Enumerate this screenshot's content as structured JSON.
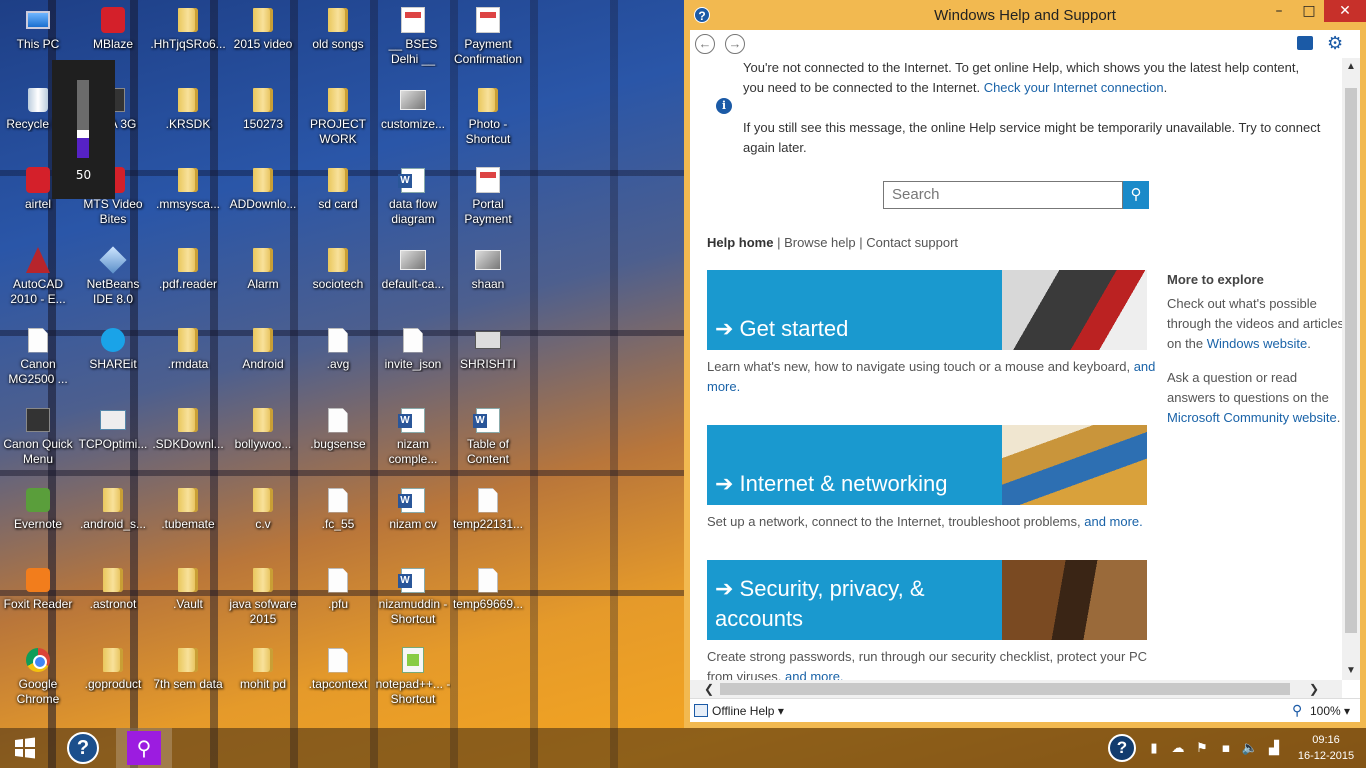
{
  "desktop": {
    "icons": [
      {
        "label": "This PC",
        "glyph": "g-pc",
        "icon": "this-pc-icon"
      },
      {
        "label": "MBlaze",
        "glyph": "g-red",
        "icon": "mblaze-icon"
      },
      {
        "label": ".HhTjqSRo6...",
        "glyph": "g-folder",
        "icon": "folder-icon"
      },
      {
        "label": "2015 video",
        "glyph": "g-folder",
        "icon": "folder-icon"
      },
      {
        "label": "old songs",
        "glyph": "g-folder",
        "icon": "folder-icon"
      },
      {
        "label": "__ BSES Delhi __",
        "glyph": "g-pdf",
        "icon": "document-icon"
      },
      {
        "label": "Payment Confirmation",
        "glyph": "g-pdf",
        "icon": "document-icon"
      },
      {
        "label": "Recycle Bin",
        "glyph": "g-bin",
        "icon": "recycle-bin-icon"
      },
      {
        "label": "TATA 3G",
        "glyph": "g-dark",
        "icon": "modem-icon"
      },
      {
        "label": ".KRSDK",
        "glyph": "g-folder",
        "icon": "folder-icon"
      },
      {
        "label": "150273",
        "glyph": "g-folder",
        "icon": "folder-icon"
      },
      {
        "label": "PROJECT WORK",
        "glyph": "g-folder",
        "icon": "folder-icon"
      },
      {
        "label": "customize...",
        "glyph": "g-img",
        "icon": "image-icon"
      },
      {
        "label": "Photo - Shortcut",
        "glyph": "g-folder",
        "icon": "folder-shortcut-icon"
      },
      {
        "label": "airtel",
        "glyph": "g-red",
        "icon": "airtel-icon"
      },
      {
        "label": "MTS Video Bites",
        "glyph": "g-red",
        "icon": "mts-icon"
      },
      {
        "label": ".mmsysca...",
        "glyph": "g-folder",
        "icon": "folder-icon"
      },
      {
        "label": "ADDownlo...",
        "glyph": "g-folder",
        "icon": "folder-icon"
      },
      {
        "label": "sd card",
        "glyph": "g-folder",
        "icon": "folder-icon"
      },
      {
        "label": "data flow diagram",
        "glyph": "g-word",
        "icon": "word-document-icon"
      },
      {
        "label": "Portal Payment",
        "glyph": "g-pdf",
        "icon": "document-icon"
      },
      {
        "label": "AutoCAD 2010 - E...",
        "glyph": "g-cad",
        "icon": "autocad-icon"
      },
      {
        "label": "NetBeans IDE 8.0",
        "glyph": "g-cube",
        "icon": "netbeans-icon"
      },
      {
        "label": ".pdf.reader",
        "glyph": "g-folder",
        "icon": "folder-icon"
      },
      {
        "label": "Alarm",
        "glyph": "g-folder",
        "icon": "folder-icon"
      },
      {
        "label": "sociotech",
        "glyph": "g-folder",
        "icon": "folder-icon"
      },
      {
        "label": "default-ca...",
        "glyph": "g-img",
        "icon": "image-icon"
      },
      {
        "label": "shaan",
        "glyph": "g-img",
        "icon": "image-icon"
      },
      {
        "label": "Canon MG2500 ...",
        "glyph": "g-doc",
        "icon": "printer-icon"
      },
      {
        "label": "SHAREit",
        "glyph": "g-blue",
        "icon": "shareit-icon"
      },
      {
        "label": ".rmdata",
        "glyph": "g-folder",
        "icon": "folder-icon"
      },
      {
        "label": "Android",
        "glyph": "g-folder",
        "icon": "folder-icon"
      },
      {
        "label": ".avg",
        "glyph": "g-doc",
        "icon": "file-icon"
      },
      {
        "label": "invite_json",
        "glyph": "g-doc",
        "icon": "file-icon"
      },
      {
        "label": "SHRISHTI",
        "glyph": "g-card",
        "icon": "drive-icon"
      },
      {
        "label": "Canon Quick Menu",
        "glyph": "g-dark",
        "icon": "canon-quick-menu-icon"
      },
      {
        "label": "TCPOptimi...",
        "glyph": "g-tcp",
        "icon": "tcp-optimizer-icon"
      },
      {
        "label": ".SDKDownl...",
        "glyph": "g-folder",
        "icon": "folder-icon"
      },
      {
        "label": "bollywoo...",
        "glyph": "g-folder",
        "icon": "folder-icon"
      },
      {
        "label": ".bugsense",
        "glyph": "g-doc",
        "icon": "file-icon"
      },
      {
        "label": "nizam comple...",
        "glyph": "g-word",
        "icon": "word-document-icon"
      },
      {
        "label": "Table of Content",
        "glyph": "g-word",
        "icon": "word-document-icon"
      },
      {
        "label": "Evernote",
        "glyph": "g-green",
        "icon": "evernote-icon"
      },
      {
        "label": ".android_s...",
        "glyph": "g-folder",
        "icon": "folder-icon"
      },
      {
        "label": ".tubemate",
        "glyph": "g-folder",
        "icon": "folder-icon"
      },
      {
        "label": "c.v",
        "glyph": "g-folder",
        "icon": "folder-icon"
      },
      {
        "label": ".fc_55",
        "glyph": "g-doc",
        "icon": "file-icon"
      },
      {
        "label": "nizam cv",
        "glyph": "g-word",
        "icon": "word-document-icon"
      },
      {
        "label": "temp22131...",
        "glyph": "g-doc",
        "icon": "file-icon"
      },
      {
        "label": "Foxit Reader",
        "glyph": "g-orange",
        "icon": "foxit-reader-icon"
      },
      {
        "label": ".astronot",
        "glyph": "g-folder",
        "icon": "folder-icon"
      },
      {
        "label": ".Vault",
        "glyph": "g-folder",
        "icon": "folder-icon"
      },
      {
        "label": "java sofware 2015",
        "glyph": "g-folder",
        "icon": "folder-icon"
      },
      {
        "label": ".pfu",
        "glyph": "g-doc",
        "icon": "file-icon"
      },
      {
        "label": "nizamuddin - Shortcut",
        "glyph": "g-word",
        "icon": "word-shortcut-icon"
      },
      {
        "label": "temp69669...",
        "glyph": "g-doc",
        "icon": "file-icon"
      },
      {
        "label": "Google Chrome",
        "glyph": "g-chrome",
        "icon": "chrome-icon"
      },
      {
        "label": ".goproduct",
        "glyph": "g-folder",
        "icon": "folder-icon"
      },
      {
        "label": "7th sem data",
        "glyph": "g-folder",
        "icon": "folder-icon"
      },
      {
        "label": "mohit pd",
        "glyph": "g-folder",
        "icon": "folder-icon"
      },
      {
        "label": ".tapcontext",
        "glyph": "g-doc",
        "icon": "file-icon"
      },
      {
        "label": "notepad++... - Shortcut",
        "glyph": "g-np",
        "icon": "notepad-plus-plus-icon"
      }
    ],
    "volume": {
      "value": "50",
      "level": 0.5
    }
  },
  "taskbar": {
    "start_icon": "windows-start-icon",
    "help_glyph": "?",
    "search_glyph": "⚲",
    "tray_help_glyph": "?",
    "clock_time": "09:16",
    "clock_date": "16-12-2015"
  },
  "window": {
    "title": "Windows Help and Support",
    "help_glyph": "?",
    "minimize": "–",
    "maximize": "□",
    "close": "✕",
    "back": "←",
    "forward": "→",
    "offline_msg_1": "You're not connected to the Internet. To get online Help, which shows you the latest help content, you need to be connected to the Internet. ",
    "offline_link": "Check your Internet connection",
    "offline_msg_1_end": ".",
    "offline_msg_2": "If you still see this message, the online Help service might be temporarily unavailable. Try to connect again later.",
    "search_placeholder": "Search",
    "nav": {
      "home": "Help home",
      "sep1": " | ",
      "browse": "Browse help",
      "sep2": " | ",
      "contact": "Contact support"
    },
    "tiles": [
      {
        "title": "➔ Get started",
        "desc": "Learn what's new, how to navigate using touch or a mouse and keyboard, ",
        "link": "and more."
      },
      {
        "title": "➔ Internet & networking",
        "desc": "Set up a network, connect to the Internet, troubleshoot problems, ",
        "link": "and more."
      },
      {
        "title": "➔ Security, privacy, & accounts",
        "desc": "Create strong passwords, run through our security checklist, protect your PC from viruses, ",
        "link": "and more."
      }
    ],
    "explore": {
      "heading": "More to explore",
      "p1": "Check out what's possible through the videos and articles on the ",
      "p1_link": "Windows website",
      "p1_end": ".",
      "p2": "Ask a question or read answers to questions on the ",
      "p2_link": "Microsoft Community website",
      "p2_end": "."
    },
    "status": {
      "offline": "Offline Help ▾",
      "zoom": "100% ▾"
    }
  },
  "colors": {
    "tile": "#1a99cf",
    "titlebar": "#f2b950",
    "close": "#c7302a",
    "link": "#1a63a8"
  }
}
